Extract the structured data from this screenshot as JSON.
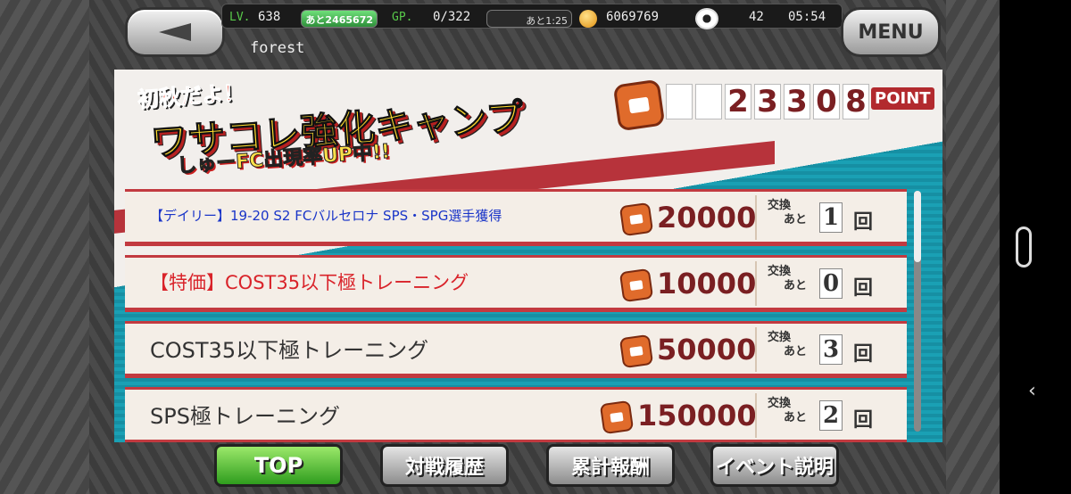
{
  "header": {
    "level_label": "LV.",
    "level_value": "638",
    "exp_remaining": "あと2465672",
    "gp_label": "GP.",
    "gp_value": "0/322",
    "gp_timer": "あと1:25",
    "coins": "6069769",
    "balls": "42",
    "clock": "05:54",
    "menu_label": "MENU",
    "username": "forest"
  },
  "banner": {
    "title_line1": "初秋だよ！",
    "title_line2": "ワサコレ強化キャンプ",
    "subtitle": "しゅーFC出現率UP中!!",
    "points": [
      "",
      "",
      "2",
      "3",
      "3",
      "0",
      "8"
    ],
    "point_word": "POINT"
  },
  "rewards": [
    {
      "title": "【デイリー】19-20 S2 FCバルセロナ SPS・SPG選手獲得",
      "cost": "20000",
      "remaining": "1"
    },
    {
      "title": "【特価】COST35以下極トレーニング",
      "cost": "10000",
      "remaining": "0"
    },
    {
      "title": "COST35以下極トレーニング",
      "cost": "50000",
      "remaining": "3"
    },
    {
      "title": "SPS極トレーニング",
      "cost": "150000",
      "remaining": "2"
    }
  ],
  "exchange": {
    "label": "交換",
    "ato": "あと",
    "unit": "回"
  },
  "buttons": {
    "top": "TOP",
    "battle_history": "対戦履歴",
    "cumulative_rewards": "累計報酬",
    "event_info": "イベント説明"
  },
  "colors": {
    "accent_red": "#c23a40",
    "cost_orange": "#e06b2b",
    "top_green": "#2f9d1e"
  },
  "icons": {
    "back": "back-arrow-icon",
    "coin": "coin-icon",
    "ball": "soccer-ball-icon",
    "point": "point-icon"
  }
}
